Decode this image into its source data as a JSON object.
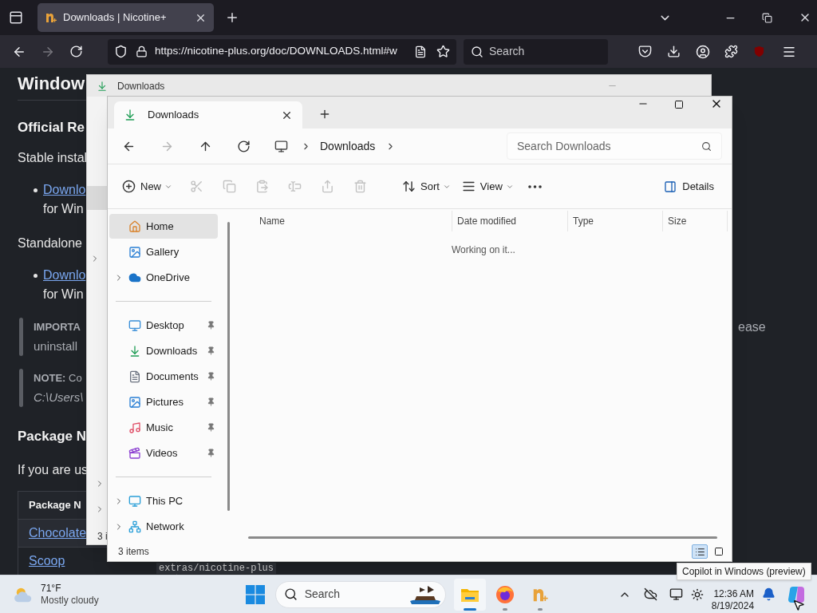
{
  "browser": {
    "tabs": [
      {
        "title": "Downloads | Nicotine+",
        "selected": true
      }
    ],
    "url": "https://nicotine-plus.org/doc/DOWNLOADS.html#w",
    "search_placeholder": "Search"
  },
  "page": {
    "blocks": [
      {
        "kind": "h2",
        "text": "Window"
      },
      {
        "kind": "h3",
        "text": "Official Re"
      },
      {
        "kind": "p",
        "text": "Stable instal"
      },
      {
        "kind": "bullet",
        "link": "Downlo",
        "text": "for Win"
      },
      {
        "kind": "p",
        "text": "Standalone"
      },
      {
        "kind": "bullet",
        "link": "Downlo",
        "text": "for Win"
      },
      {
        "kind": "note",
        "label": "IMPORTA",
        "line2": "uninstall",
        "italic": false
      },
      {
        "kind": "note",
        "label": "NOTE:",
        "text": "Co",
        "line2": "C:\\Users\\",
        "italic": true
      },
      {
        "kind": "h3",
        "text": "Package N"
      },
      {
        "kind": "p",
        "text": "If you are us"
      },
      {
        "kind": "table",
        "header": "Package N",
        "rows": [
          "Chocolate",
          "Scoop"
        ]
      }
    ],
    "right_fragment": "ease",
    "code_fragment": "extras/nicotine-plus"
  },
  "back_window": {
    "tab_title": "Downloads",
    "status": "3 i"
  },
  "explorer": {
    "tabs": [
      {
        "title": "Downloads",
        "selected": true
      }
    ],
    "nav": [
      {
        "kind": "back",
        "disabled": false
      },
      {
        "kind": "forward",
        "disabled": true
      },
      {
        "kind": "up",
        "disabled": false
      },
      {
        "kind": "refresh",
        "disabled": false
      }
    ],
    "breadcrumb": [
      "Downloads"
    ],
    "search_placeholder": "Search Downloads",
    "commands": [
      {
        "kind": "new",
        "label": "New",
        "dropdown": true,
        "disabled": false
      },
      {
        "kind": "cut",
        "disabled": true
      },
      {
        "kind": "copy",
        "disabled": true
      },
      {
        "kind": "paste",
        "disabled": true
      },
      {
        "kind": "rename",
        "disabled": true
      },
      {
        "kind": "share",
        "disabled": true
      },
      {
        "kind": "delete",
        "disabled": true
      },
      {
        "kind": "sort",
        "label": "Sort",
        "dropdown": true,
        "disabled": false
      },
      {
        "kind": "view",
        "label": "View",
        "dropdown": true,
        "disabled": false
      },
      {
        "kind": "more",
        "disabled": false
      }
    ],
    "details_label": "Details",
    "sidebar": [
      {
        "items": [
          {
            "kind": "home",
            "label": "Home",
            "selected": true,
            "expandable": false,
            "pinned": false
          },
          {
            "kind": "gallery",
            "label": "Gallery",
            "selected": false,
            "expandable": false,
            "pinned": false
          },
          {
            "kind": "onedrive",
            "label": "OneDrive",
            "selected": false,
            "expandable": true,
            "pinned": false
          }
        ]
      },
      {
        "items": [
          {
            "kind": "desktop",
            "label": "Desktop",
            "selected": false,
            "expandable": false,
            "pinned": true
          },
          {
            "kind": "downloads",
            "label": "Downloads",
            "selected": false,
            "expandable": false,
            "pinned": true
          },
          {
            "kind": "documents",
            "label": "Documents",
            "selected": false,
            "expandable": false,
            "pinned": true
          },
          {
            "kind": "pictures",
            "label": "Pictures",
            "selected": false,
            "expandable": false,
            "pinned": true
          },
          {
            "kind": "music",
            "label": "Music",
            "selected": false,
            "expandable": false,
            "pinned": true
          },
          {
            "kind": "videos",
            "label": "Videos",
            "selected": false,
            "expandable": false,
            "pinned": true
          }
        ]
      },
      {
        "items": [
          {
            "kind": "thispc",
            "label": "This PC",
            "selected": false,
            "expandable": true,
            "pinned": false
          },
          {
            "kind": "network",
            "label": "Network",
            "selected": false,
            "expandable": true,
            "pinned": false
          }
        ]
      }
    ],
    "columns": [
      "Name",
      "Date modified",
      "Type",
      "Size"
    ],
    "status_message": "Working on it...",
    "item_count": "3 items",
    "view_modes": [
      {
        "kind": "details",
        "selected": true
      },
      {
        "kind": "tiles",
        "selected": false
      }
    ]
  },
  "taskbar": {
    "weather": {
      "temp": "71°F",
      "condition": "Mostly cloudy"
    },
    "search_placeholder": "Search",
    "apps": [
      {
        "kind": "explorer",
        "active": true
      },
      {
        "kind": "firefox",
        "active": false
      },
      {
        "kind": "nicotine",
        "active": false
      }
    ],
    "clock": {
      "time": "12:36 AM",
      "date": "8/19/2024"
    },
    "tooltip": "Copilot in Windows (preview)"
  }
}
